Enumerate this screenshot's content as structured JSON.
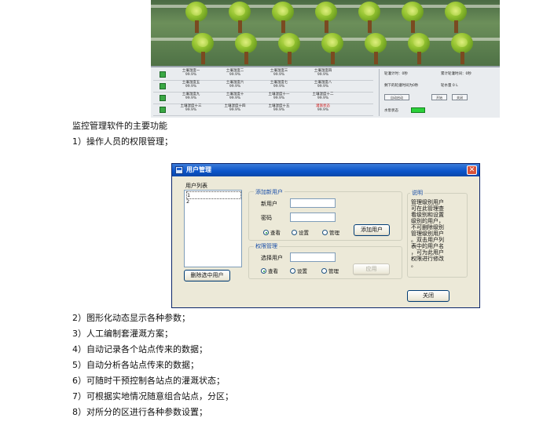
{
  "field_panel": {
    "sensor_rows": [
      {
        "cells": [
          {
            "name": "土壤湿度一",
            "value": "99.9%"
          },
          {
            "name": "土壤湿度二",
            "value": "99.9%"
          },
          {
            "name": "土壤湿度三",
            "value": "99.9%"
          },
          {
            "name": "土壤湿度四",
            "value": "99.9%"
          }
        ]
      },
      {
        "cells": [
          {
            "name": "土壤湿度五",
            "value": "99.9%"
          },
          {
            "name": "土壤湿度六",
            "value": "99.9%"
          },
          {
            "name": "土壤湿度七",
            "value": "99.9%"
          },
          {
            "name": "土壤湿度八",
            "value": "99.9%"
          }
        ]
      },
      {
        "cells": [
          {
            "name": "土壤湿度九",
            "value": "99.9%"
          },
          {
            "name": "土壤湿度十",
            "value": "99.9%"
          },
          {
            "name": "土壤湿度十一",
            "value": "99.9%"
          },
          {
            "name": "土壤湿度十二",
            "value": "99.9%"
          }
        ]
      },
      {
        "cells": [
          {
            "name": "土壤湿度十三",
            "value": "99.9%"
          },
          {
            "name": "土壤湿度十四",
            "value": "99.9%"
          },
          {
            "name": "土壤湿度十五",
            "value": "99.9%"
          },
          {
            "name": "灌溉状态",
            "value": "99.9%",
            "alert": true
          }
        ]
      }
    ],
    "info": {
      "run_time": "轮灌计时：0秒",
      "total_time": "累计轮灌时间：0秒",
      "next_time": "剩下的轮灌时间为0秒",
      "water_amount": "轮水量 0 L",
      "auto_button": "自动启动",
      "stop_button": "开始",
      "close_button": "关闭",
      "pump_status": "水泵状态",
      "indicator_color": "#2bd13a"
    }
  },
  "text": {
    "main_heading": "监控管理软件的主要功能",
    "item1": "1）操作人员的权限管理；",
    "item2": "2）图形化动态显示各种参数；",
    "item3": "3）人工编制套灌溉方案；",
    "item4": "4）自动记录各个站点传来的数据；",
    "item5": "5）自动分析各站点传来的数据；",
    "item6": "6）可随时干预控制各站点的灌溉状态；",
    "item7": "7）可根据实地情况随意组合站点，分区；",
    "item8": "8）对所分的区进行各种参数设置；"
  },
  "dialog": {
    "title": "用户管理",
    "close_glyph": "✕",
    "user_list_label": "用户列表",
    "users": [
      "1",
      "2"
    ],
    "delete_button": "删除选中用户",
    "add_group": {
      "legend": "添加新用户",
      "new_user_label": "新用户",
      "password_label": "密码",
      "radios": [
        "查看",
        "设置",
        "管理"
      ],
      "add_button": "添加用户"
    },
    "perm_group": {
      "legend": "权限管理",
      "select_user_label": "选择用户",
      "radios": [
        "查看",
        "设置",
        "管理"
      ],
      "apply_button": "应用"
    },
    "desc_group": {
      "legend": "说明",
      "text": "管理级别用户\n可在此管理查\n看级别和设置\n级别的用户，\n不可删除级别\n管理级别用户\n。双击用户列\n表中的用户名\n，可为此用户\n权限进行修改\n。"
    },
    "close_button": "关闭"
  }
}
